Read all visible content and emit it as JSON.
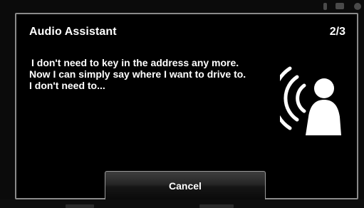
{
  "dialog": {
    "title": "Audio Assistant",
    "page_indicator": "2/3",
    "message_lines": [
      "I don't need to key in the address any more.",
      "Now I can simply say where I want to drive to.",
      "I don't need to..."
    ],
    "cancel_label": "Cancel",
    "icon": "voice-speaker-icon"
  }
}
